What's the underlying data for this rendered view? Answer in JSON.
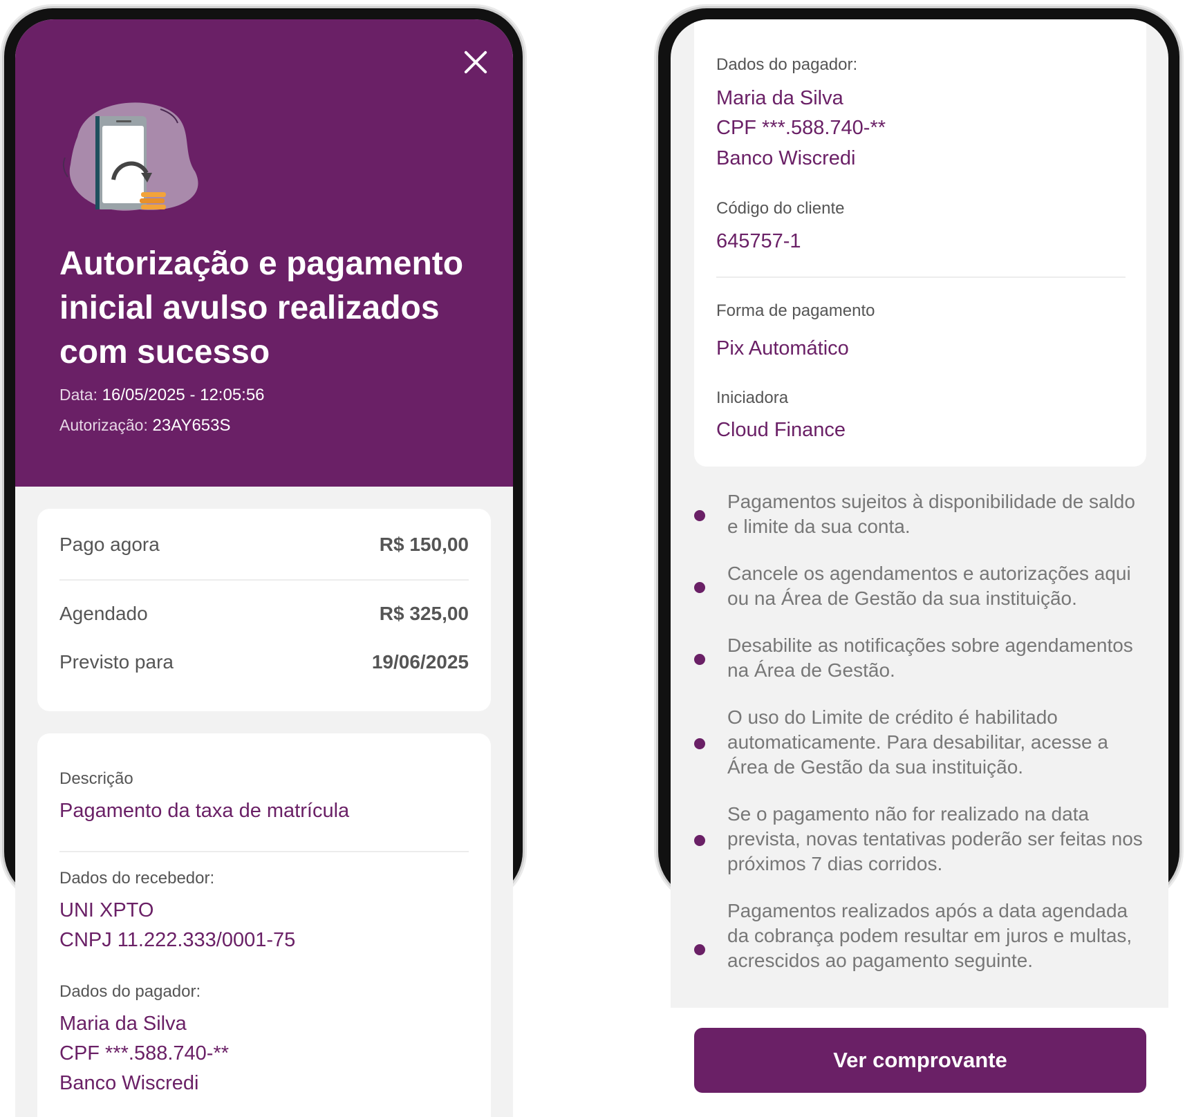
{
  "left": {
    "close_label": "×",
    "title": "Autorização e pagamento inicial avulso realizados com sucesso",
    "date_label": "Data:",
    "date_value": "16/05/2025 - 12:05:56",
    "auth_label": "Autorização:",
    "auth_value": "23AY653S",
    "amounts": {
      "paid_label": "Pago agora",
      "paid_value": "R$ 150,00",
      "scheduled_label": "Agendado",
      "scheduled_value": "R$ 325,00",
      "expected_label": "Previsto para",
      "expected_value": "19/06/2025"
    },
    "details": {
      "desc_label": "Descrição",
      "desc_value": "Pagamento da taxa de matrícula",
      "receiver_label": "Dados do recebedor:",
      "receiver_name": "UNI XPTO",
      "receiver_cnpj": "CNPJ 11.222.333/0001-75",
      "payer_label": "Dados do pagador:",
      "payer_name": "Maria da Silva",
      "payer_cpf": "CPF ***.588.740-**",
      "payer_bank": "Banco Wiscredi"
    }
  },
  "right": {
    "payer_label": "Dados do pagador:",
    "payer_name": "Maria da Silva",
    "payer_cpf": "CPF ***.588.740-**",
    "payer_bank": "Banco Wiscredi",
    "client_code_label": "Código do cliente",
    "client_code_value": "645757-1",
    "payment_method_label": "Forma de pagamento",
    "payment_method_value": "Pix Automático",
    "initiator_label": "Iniciadora",
    "initiator_value": "Cloud Finance",
    "bullets": [
      "Pagamentos sujeitos à disponibilidade de saldo e limite da sua conta.",
      "Cancele os agendamentos e autorizações aqui ou na Área de Gestão da sua instituição.",
      "Desabilite as notificações sobre agendamentos na Área de Gestão.",
      "O uso do Limite de crédito é habilitado automaticamente. Para desabilitar, acesse a Área de Gestão da sua instituição.",
      "Se o pagamento não for realizado na data prevista, novas tentativas poderão ser feitas nos próximos 7 dias corridos.",
      "Pagamentos realizados após a data agendada da cobrança podem resultar em juros e multas, acrescidos ao pagamento seguinte."
    ],
    "button_label": "Ver comprovante"
  },
  "colors": {
    "brand": "#6a2066",
    "background": "#f2f2f2",
    "card": "#ffffff"
  },
  "icons": [
    "close-icon",
    "phone-payment-illustration",
    "bullet-dot-icon"
  ]
}
